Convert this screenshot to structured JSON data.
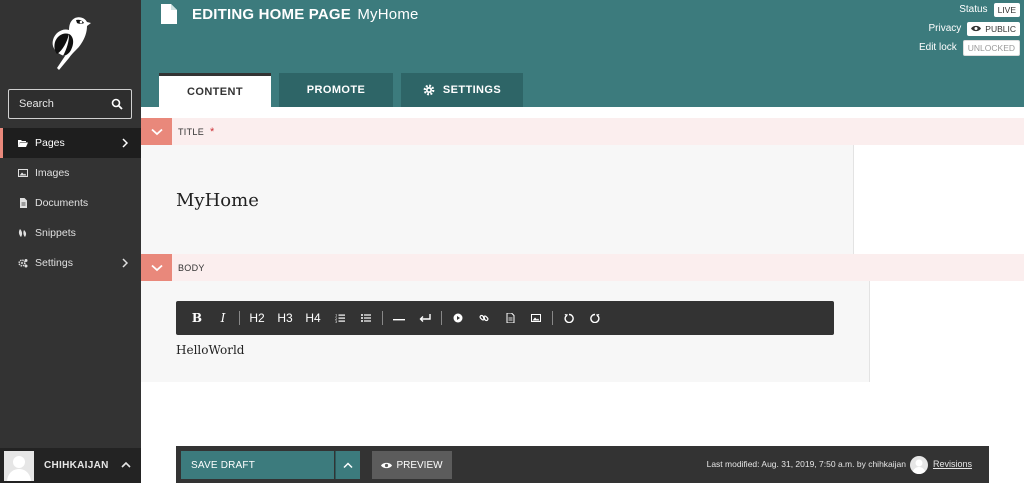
{
  "sidebar": {
    "search_placeholder": "Search",
    "items": [
      {
        "label": "Pages",
        "icon": "folder-open-icon",
        "active": true,
        "has_children": true
      },
      {
        "label": "Images",
        "icon": "image-icon",
        "active": false,
        "has_children": false
      },
      {
        "label": "Documents",
        "icon": "document-icon",
        "active": false,
        "has_children": false
      },
      {
        "label": "Snippets",
        "icon": "snippet-icon",
        "active": false,
        "has_children": false
      },
      {
        "label": "Settings",
        "icon": "cogs-icon",
        "active": false,
        "has_children": true
      }
    ],
    "account_name": "CHIHKAIJAN"
  },
  "header": {
    "title_bold": "EDITING HOME PAGE",
    "title_page": "MyHome",
    "status_label": "Status",
    "status_value": "LIVE",
    "privacy_label": "Privacy",
    "privacy_value": "PUBLIC",
    "lock_label": "Edit lock",
    "lock_value": "UNLOCKED"
  },
  "tabs": [
    {
      "label": "CONTENT",
      "active": true
    },
    {
      "label": "PROMOTE",
      "active": false
    },
    {
      "label": "SETTINGS",
      "active": false
    }
  ],
  "fields": {
    "title_label": "TITLE",
    "title_required": "*",
    "title_value": "MyHome",
    "body_label": "BODY",
    "body_value": "HelloWorld"
  },
  "toolbar": {
    "bold": "B",
    "italic": "I",
    "h2": "H2",
    "h3": "H3",
    "h4": "H4"
  },
  "footer": {
    "save_draft": "SAVE DRAFT",
    "preview": "PREVIEW",
    "last_modified": "Last modified: Aug. 31, 2019, 7:50 a.m. by chihkaijan",
    "revisions": "Revisions"
  },
  "colors": {
    "teal": "#3c7b7d",
    "teal_dark": "#2e6567",
    "sidebar": "#333333",
    "salmon": "#e9887b",
    "section_bg": "#fbeeee"
  }
}
